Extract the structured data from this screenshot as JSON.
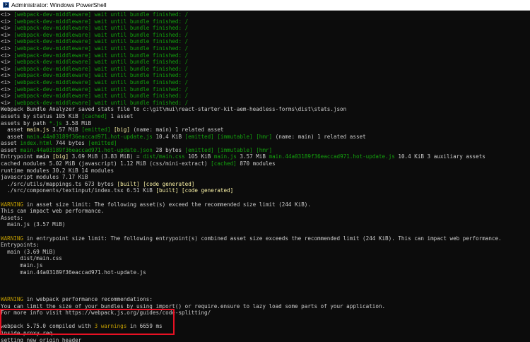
{
  "window": {
    "title": "Administrator: Windows PowerShell",
    "icon": "powershell-icon"
  },
  "terminal": {
    "colors": {
      "background": "#0c0c0c",
      "text": "#cccccc",
      "green": "#13a10e",
      "yellow": "#c19c00",
      "highlight_border": "#e81123"
    },
    "wait_lines": [
      "<i> [webpack-dev-middleware] wait until bundle finished: /",
      "<i> [webpack-dev-middleware] wait until bundle finished: /",
      "<i> [webpack-dev-middleware] wait until bundle finished: /",
      "<i> [webpack-dev-middleware] wait until bundle finished: /",
      "<i> [webpack-dev-middleware] wait until bundle finished: /",
      "<i> [webpack-dev-middleware] wait until bundle finished: /",
      "<i> [webpack-dev-middleware] wait until bundle finished: /",
      "<i> [webpack-dev-middleware] wait until bundle finished: /",
      "<i> [webpack-dev-middleware] wait until bundle finished: /",
      "<i> [webpack-dev-middleware] wait until bundle finished: /",
      "<i> [webpack-dev-middleware] wait until bundle finished: /",
      "<i> [webpack-dev-middleware] wait until bundle finished: /",
      "<i> [webpack-dev-middleware] wait until bundle finished: /",
      "<i> [webpack-dev-middleware] wait until bundle finished: /"
    ],
    "lines": [
      [
        {
          "t": "Webpack Bundle Analyzer saved stats file to c:\\git\\mui\\react-starter-kit-aem-headless-forms\\dist\\stats.json",
          "c": "w"
        }
      ],
      [
        {
          "t": "assets by status 105 KiB ",
          "c": "w"
        },
        {
          "t": "[cached]",
          "c": "g"
        },
        {
          "t": " 1 asset",
          "c": "w"
        }
      ],
      [
        {
          "t": "assets by path ",
          "c": "w"
        },
        {
          "t": "*.js",
          "c": "g"
        },
        {
          "t": " 3.58 MiB",
          "c": "w"
        }
      ],
      [
        {
          "t": "  asset ",
          "c": "w"
        },
        {
          "t": "main.js",
          "c": "yb"
        },
        {
          "t": " 3.57 MiB ",
          "c": "w"
        },
        {
          "t": "[emitted]",
          "c": "g"
        },
        {
          "t": " ",
          "c": "w"
        },
        {
          "t": "[big]",
          "c": "yb"
        },
        {
          "t": " (name: main) 1 related asset",
          "c": "w"
        }
      ],
      [
        {
          "t": "  asset ",
          "c": "w"
        },
        {
          "t": "main.44a03189f36eaccad971.hot-update.js",
          "c": "g"
        },
        {
          "t": " 10.4 KiB ",
          "c": "w"
        },
        {
          "t": "[emitted]",
          "c": "g"
        },
        {
          "t": " ",
          "c": "w"
        },
        {
          "t": "[immutable]",
          "c": "g"
        },
        {
          "t": " ",
          "c": "w"
        },
        {
          "t": "[hmr]",
          "c": "g"
        },
        {
          "t": " (name: main) 1 related asset",
          "c": "w"
        }
      ],
      [
        {
          "t": "asset ",
          "c": "w"
        },
        {
          "t": "index.html",
          "c": "g"
        },
        {
          "t": " 744 bytes ",
          "c": "w"
        },
        {
          "t": "[emitted]",
          "c": "g"
        }
      ],
      [
        {
          "t": "asset ",
          "c": "w"
        },
        {
          "t": "main.44a03189f36eaccad971.hot-update.json",
          "c": "g"
        },
        {
          "t": " 28 bytes ",
          "c": "w"
        },
        {
          "t": "[emitted]",
          "c": "g"
        },
        {
          "t": " ",
          "c": "w"
        },
        {
          "t": "[immutable]",
          "c": "g"
        },
        {
          "t": " ",
          "c": "w"
        },
        {
          "t": "[hmr]",
          "c": "g"
        }
      ],
      [
        {
          "t": "Entrypoint ",
          "c": "w"
        },
        {
          "t": "main",
          "c": "b w"
        },
        {
          "t": " ",
          "c": "w"
        },
        {
          "t": "[big]",
          "c": "yb"
        },
        {
          "t": " 3.69 MiB (3.83 MiB) = ",
          "c": "w"
        },
        {
          "t": "dist/main.css",
          "c": "g"
        },
        {
          "t": " 105 KiB ",
          "c": "w"
        },
        {
          "t": "main.js",
          "c": "g"
        },
        {
          "t": " 3.57 MiB ",
          "c": "w"
        },
        {
          "t": "main.44a03189f36eaccad971.hot-update.js",
          "c": "g"
        },
        {
          "t": " 10.4 KiB 3 auxiliary assets",
          "c": "w"
        }
      ],
      [
        {
          "t": "cached modules 5.02 MiB (javascript) 1.12 MiB (css/mini-extract) ",
          "c": "w"
        },
        {
          "t": "[cached]",
          "c": "g"
        },
        {
          "t": " 870 modules",
          "c": "w"
        }
      ],
      [
        {
          "t": "runtime modules 30.2 KiB 14 modules",
          "c": "w"
        }
      ],
      [
        {
          "t": "javascript modules 7.17 KiB",
          "c": "w"
        }
      ],
      [
        {
          "t": "  ./src/utils/mappings.ts 673 bytes ",
          "c": "w"
        },
        {
          "t": "[built]",
          "c": "yb"
        },
        {
          "t": " ",
          "c": "w"
        },
        {
          "t": "[code generated]",
          "c": "yb"
        }
      ],
      [
        {
          "t": "  ./src/components/textinput/index.tsx 6.51 KiB ",
          "c": "w"
        },
        {
          "t": "[built]",
          "c": "yb"
        },
        {
          "t": " ",
          "c": "w"
        },
        {
          "t": "[code generated]",
          "c": "yb"
        }
      ],
      [
        {
          "t": "",
          "c": "w"
        }
      ],
      [
        {
          "t": "WARNING",
          "c": "y"
        },
        {
          "t": " in asset size limit: The following asset(s) exceed the recommended size limit (244 KiB).",
          "c": "w"
        }
      ],
      [
        {
          "t": "This can impact web performance.",
          "c": "w"
        }
      ],
      [
        {
          "t": "Assets:",
          "c": "w"
        }
      ],
      [
        {
          "t": "  main.js (3.57 MiB)",
          "c": "w"
        }
      ],
      [
        {
          "t": "",
          "c": "w"
        }
      ],
      [
        {
          "t": "WARNING",
          "c": "y"
        },
        {
          "t": " in entrypoint size limit: The following entrypoint(s) combined asset size exceeds the recommended limit (244 KiB). This can impact web performance.",
          "c": "w"
        }
      ],
      [
        {
          "t": "Entrypoints:",
          "c": "w"
        }
      ],
      [
        {
          "t": "  main (3.69 MiB)",
          "c": "w"
        }
      ],
      [
        {
          "t": "      dist/main.css",
          "c": "w"
        }
      ],
      [
        {
          "t": "      main.js",
          "c": "w"
        }
      ],
      [
        {
          "t": "      main.44a03189f36eaccad971.hot-update.js",
          "c": "w"
        }
      ],
      [
        {
          "t": "",
          "c": "w"
        }
      ],
      [
        {
          "t": "",
          "c": "w"
        }
      ],
      [
        {
          "t": "",
          "c": "w"
        }
      ],
      [
        {
          "t": "WARNING",
          "c": "y"
        },
        {
          "t": " in webpack performance recommendations:",
          "c": "w"
        }
      ],
      [
        {
          "t": "You can limit the size of your bundles by using import() or require.ensure to lazy load some parts of your application.",
          "c": "w"
        }
      ],
      [
        {
          "t": "For more info visit https://webpack.js.org/guides/code-splitting/",
          "c": "w"
        }
      ],
      [
        {
          "t": "",
          "c": "w"
        }
      ],
      [
        {
          "t": "webpack 5.75.0 compiled ",
          "c": "w"
        },
        {
          "t": "with ",
          "c": "w"
        },
        {
          "t": "3 warnings",
          "c": "y"
        },
        {
          "t": " in 6659 ms",
          "c": "w"
        }
      ],
      [
        {
          "t": "inside proxy req",
          "c": "w"
        }
      ],
      [
        {
          "t": "setting new origin header",
          "c": "w"
        }
      ]
    ]
  }
}
